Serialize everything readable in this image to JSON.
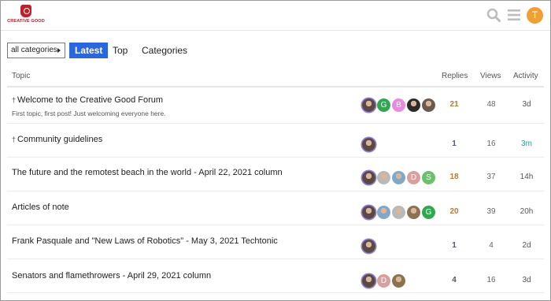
{
  "header": {
    "logo_text": "CREATIVE GOOD",
    "user_initial": "T",
    "colors": {
      "brand": "#c0202a",
      "user_avatar": "#f0a030",
      "accent": "#2867e0"
    }
  },
  "nav": {
    "category_select": "all categories",
    "tabs": [
      "Latest",
      "Top",
      "Categories"
    ]
  },
  "table": {
    "headers": {
      "topic": "Topic",
      "replies": "Replies",
      "views": "Views",
      "activity": "Activity"
    },
    "rows": [
      {
        "title": "Welcome to the Creative Good Forum",
        "pinned": true,
        "excerpt": "First topic, first post! Just welcoming everyone here.",
        "posters": [
          {
            "type": "photo",
            "color": "#5b4a44"
          },
          {
            "type": "letter",
            "letter": "G",
            "color": "#2fa84f"
          },
          {
            "type": "letter",
            "letter": "B",
            "color": "#e78be0"
          },
          {
            "type": "photo",
            "color": "#2b2b2b"
          },
          {
            "type": "photo",
            "color": "#6e5a4c"
          }
        ],
        "replies": "21",
        "views": "48",
        "activity": "3d"
      },
      {
        "title": "Community guidelines",
        "pinned": true,
        "excerpt": "",
        "posters": [
          {
            "type": "photo",
            "color": "#5b4a44"
          }
        ],
        "replies": "1",
        "views": "16",
        "activity": "3m"
      },
      {
        "title": "The future and the remotest beach in the world - April 22, 2021 column",
        "pinned": false,
        "excerpt": "",
        "posters": [
          {
            "type": "photo",
            "color": "#5b4a44"
          },
          {
            "type": "photo",
            "color": "#b9b9b9"
          },
          {
            "type": "photo",
            "color": "#7fa9c9"
          },
          {
            "type": "letter",
            "letter": "D",
            "color": "#d9a0a0"
          },
          {
            "type": "letter",
            "letter": "S",
            "color": "#6cc06a"
          }
        ],
        "replies": "18",
        "views": "37",
        "activity": "14h"
      },
      {
        "title": "Articles of note",
        "pinned": false,
        "excerpt": "",
        "posters": [
          {
            "type": "photo",
            "color": "#5b4a44"
          },
          {
            "type": "photo",
            "color": "#7fa9c9"
          },
          {
            "type": "photo",
            "color": "#b9b9b9"
          },
          {
            "type": "photo",
            "color": "#8c7250"
          },
          {
            "type": "letter",
            "letter": "G",
            "color": "#2fa84f"
          }
        ],
        "replies": "20",
        "views": "39",
        "activity": "20h"
      },
      {
        "title": "Frank Pasquale and \"New Laws of Robotics\" - May 3, 2021 Techtonic",
        "pinned": false,
        "excerpt": "",
        "posters": [
          {
            "type": "photo",
            "color": "#5b4a44"
          }
        ],
        "replies": "1",
        "views": "4",
        "activity": "2d"
      },
      {
        "title": "Senators and flamethrowers - April 29, 2021 column",
        "pinned": false,
        "excerpt": "",
        "posters": [
          {
            "type": "photo",
            "color": "#5b4a44"
          },
          {
            "type": "letter",
            "letter": "D",
            "color": "#d9a0a0"
          },
          {
            "type": "photo",
            "color": "#8c7250"
          }
        ],
        "replies": "4",
        "views": "16",
        "activity": "3d"
      }
    ]
  }
}
